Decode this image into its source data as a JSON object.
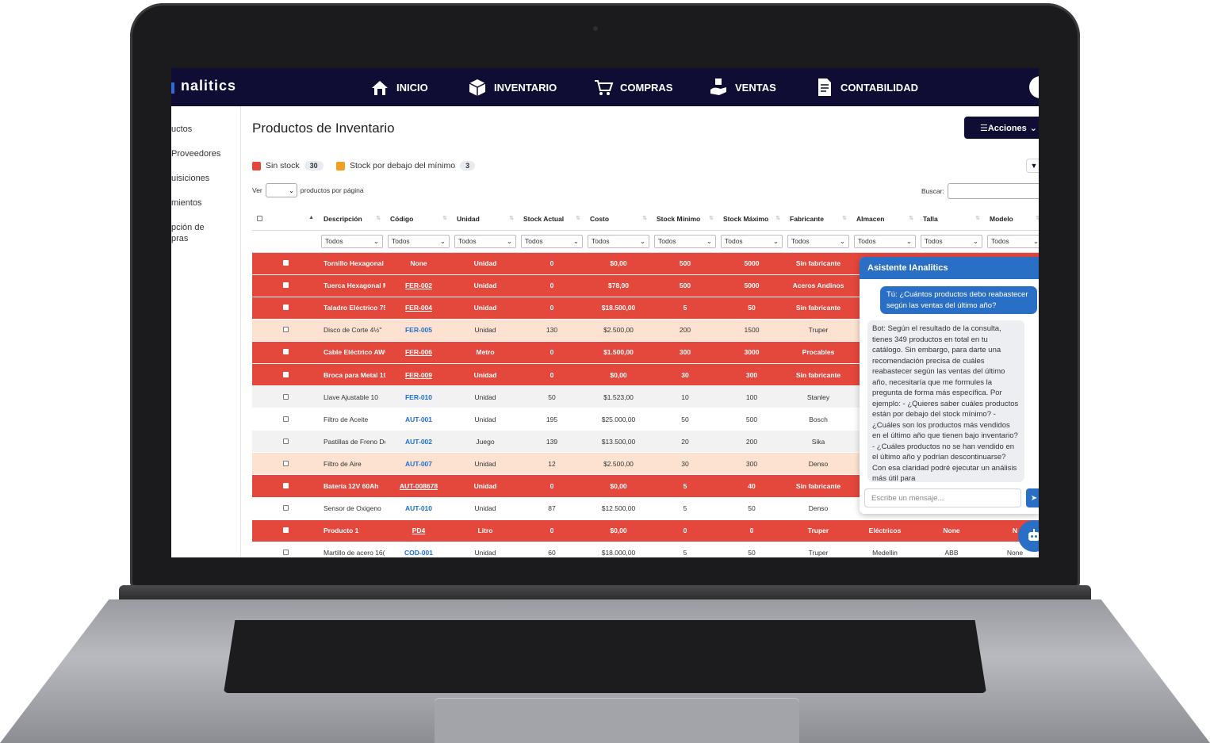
{
  "app": {
    "brand": "nalitics",
    "nav": [
      {
        "label": "INICIO",
        "icon": "home-icon"
      },
      {
        "label": "INVENTARIO",
        "icon": "inventory-icon"
      },
      {
        "label": "COMPRAS",
        "icon": "cart-icon"
      },
      {
        "label": "VENTAS",
        "icon": "sales-icon"
      },
      {
        "label": "CONTABILIDAD",
        "icon": "document-icon"
      }
    ]
  },
  "sidebar": {
    "items": [
      "uctos",
      "Proveedores",
      "uisiciones",
      "mientos",
      "pción de",
      "pras"
    ]
  },
  "page": {
    "title": "Productos de Inventario",
    "actions_label": "☰Acciones"
  },
  "legend": {
    "items": [
      {
        "label": "Sin stock",
        "count": "30",
        "color": "#e4473c"
      },
      {
        "label": "Stock por debajo del mínimo",
        "count": "3",
        "color": "#f0a020"
      }
    ]
  },
  "table_controls": {
    "show_label": "Ver",
    "per_page_label": "productos por página",
    "search_label": "Buscar:"
  },
  "table": {
    "columns": [
      "Descripción",
      "Código",
      "Unidad",
      "Stock Actual",
      "Costo",
      "Stock Mínimo",
      "Stock Máximo",
      "Fabricante",
      "Almacen",
      "Talla",
      "Modelo"
    ],
    "filter_value": "Todos",
    "rows": [
      {
        "style": "red",
        "cells": [
          "Tornillo Hexagonal I",
          "None",
          "Unidad",
          "0",
          "$0,00",
          "500",
          "5000",
          "Sin fabricante",
          "",
          "",
          ""
        ],
        "link": false
      },
      {
        "style": "red",
        "cells": [
          "Tuerca Hexagonal M",
          "FER-002",
          "Unidad",
          "0",
          "$78,00",
          "500",
          "5000",
          "Aceros Andinos",
          "",
          "",
          ""
        ],
        "link": true
      },
      {
        "style": "red",
        "cells": [
          "Taladro Eléctrico 75(",
          "FER-004",
          "Unidad",
          "0",
          "$18.500,00",
          "5",
          "50",
          "Sin fabricante",
          "",
          "",
          ""
        ],
        "link": true
      },
      {
        "style": "orange",
        "cells": [
          "Disco de Corte 4½\"",
          "FER-005",
          "Unidad",
          "130",
          "$2.500,00",
          "200",
          "1500",
          "Truper",
          "",
          "",
          ""
        ],
        "link": true
      },
      {
        "style": "red",
        "cells": [
          "Cable Eléctrico AWG",
          "FER-006",
          "Metro",
          "0",
          "$1.500,00",
          "300",
          "3000",
          "Procables",
          "",
          "",
          ""
        ],
        "link": true
      },
      {
        "style": "red",
        "cells": [
          "Broca para Metal 10",
          "FER-009",
          "Unidad",
          "0",
          "$0,00",
          "30",
          "300",
          "Sin fabricante",
          "",
          "",
          ""
        ],
        "link": true
      },
      {
        "style": "gray",
        "cells": [
          "Llave Ajustable 10",
          "FER-010",
          "Unidad",
          "50",
          "$1.523,00",
          "10",
          "100",
          "Stanley",
          "",
          "",
          ""
        ],
        "link": true
      },
      {
        "style": "white",
        "cells": [
          "Filtro de Aceite",
          "AUT-001",
          "Unidad",
          "195",
          "$25.000,00",
          "50",
          "500",
          "Bosch",
          "",
          "",
          ""
        ],
        "link": true
      },
      {
        "style": "gray",
        "cells": [
          "Pastillas de Freno De",
          "AUT-002",
          "Juego",
          "139",
          "$13.500,00",
          "20",
          "200",
          "Sika",
          "",
          "",
          ""
        ],
        "link": true
      },
      {
        "style": "orange",
        "cells": [
          "Filtro de Aire",
          "AUT-007",
          "Unidad",
          "12",
          "$2.500,00",
          "30",
          "300",
          "Denso",
          "",
          "",
          ""
        ],
        "link": true
      },
      {
        "style": "red",
        "cells": [
          "Batería 12V 60Ah",
          "AUT-008678",
          "Unidad",
          "0",
          "$0,00",
          "5",
          "40",
          "Sin fabricante",
          "",
          "",
          ""
        ],
        "link": true
      },
      {
        "style": "white",
        "cells": [
          "Sensor de Oxigeno",
          "AUT-010",
          "Unidad",
          "87",
          "$12.500,00",
          "5",
          "50",
          "Denso",
          "",
          "",
          ""
        ],
        "link": true
      },
      {
        "style": "red",
        "cells": [
          "Producto 1",
          "PD4",
          "Litro",
          "0",
          "$0,00",
          "0",
          "0",
          "Truper",
          "Eléctricos",
          "None",
          "N"
        ],
        "link": true
      },
      {
        "style": "white",
        "cells": [
          "Martillo de acero 16(",
          "COD-001",
          "Unidad",
          "60",
          "$18.000,00",
          "5",
          "50",
          "Truper",
          "Medellin",
          "ABB",
          "None"
        ],
        "link": true
      }
    ]
  },
  "chat": {
    "title": "Asistente IAnalitics",
    "user_message": "Tú: ¿Cuántos productos debo reabastecer según las ventas del último año?",
    "bot_message": "Bot: Según el resultado de la consulta, tienes 349 productos en total en tu catálogo. Sin embargo, para darte una recomendación precisa de cuáles reabastecer según las ventas del último año, necesitaría que me formules la pregunta de forma más específica. Por ejemplo: - ¿Quieres saber cuáles productos están por debajo del stock mínimo? - ¿Cuáles son los productos más vendidos en el último año que tienen bajo inventario? - ¿Cuáles productos no se han vendido en el último año y podrían descontinuarse? Con esa claridad podré ejecutar un análisis más útil para",
    "input_placeholder": "Escribe un mensaje..."
  },
  "colors": {
    "navbar": "#0f0d33",
    "accent": "#2a6fc6",
    "no_stock": "#e4473c",
    "below_min": "#fde2d1"
  }
}
